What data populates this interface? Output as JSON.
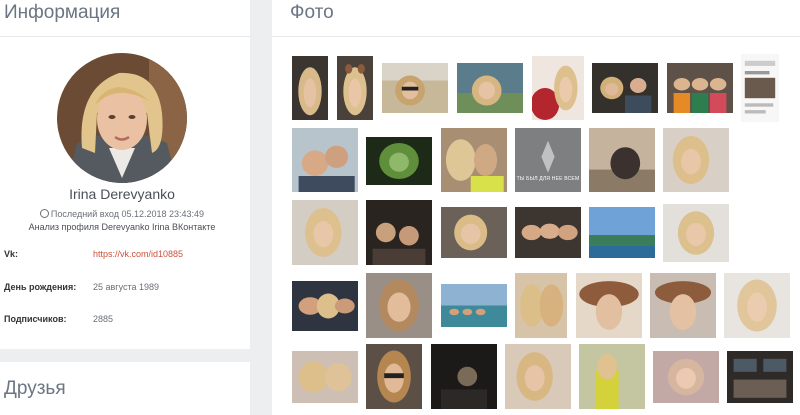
{
  "info": {
    "title": "Информация",
    "name": "Irina Derevyanko",
    "last_seen_icon": "clock-icon",
    "last_seen": "Последний вход 05.12.2018 23:43:49",
    "analysis": "Анализ профиля Derevyanko Irina ВКонтакте",
    "rows": [
      {
        "label": "Vk:",
        "value": "https://vk.com/id10885"
      },
      {
        "label": "День рождения:",
        "value": "25 августа 1989"
      },
      {
        "label": "Подписчиков:",
        "value": "2885"
      }
    ]
  },
  "friends": {
    "title": "Друзья"
  },
  "photos": {
    "title": "Фото",
    "thumb_text": "ТЫ БЫЛ ДЛЯ НЕЕ ВСЕМ"
  },
  "colors": {
    "background": "#edeef0",
    "panel": "#ffffff",
    "title_text": "#6b7583",
    "link": "#c9523b"
  }
}
